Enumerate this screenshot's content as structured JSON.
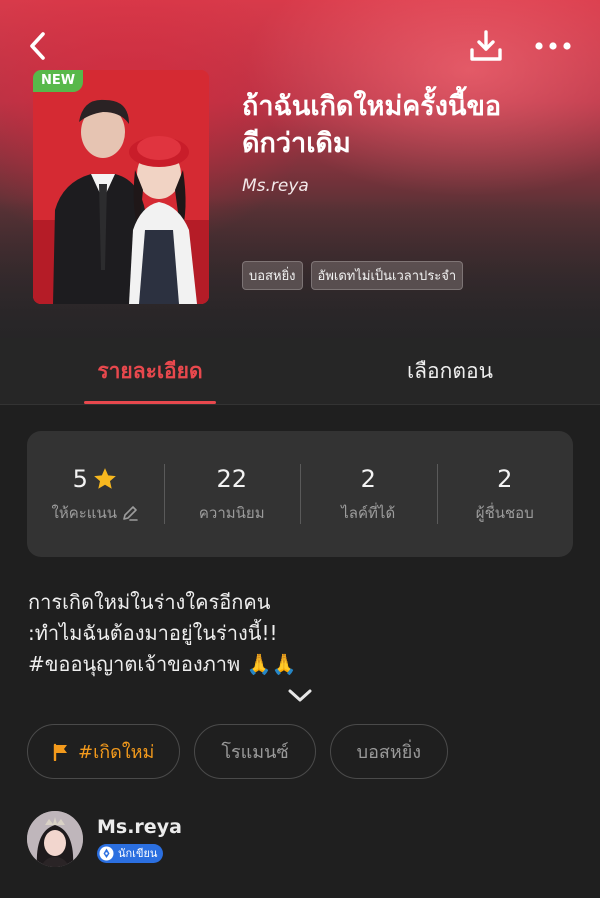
{
  "header": {
    "back_icon": "chevron-left-icon",
    "download_icon": "download-icon",
    "more_icon": "more-horizontal-icon"
  },
  "novel": {
    "badge": "NEW",
    "title_line1": "ถ้าฉันเกิดใหม่ครั้งนี้ขอ",
    "title_line2": "ดีกว่าเดิม",
    "author": "Ms.reya",
    "tags": [
      "บอสหยิ่ง",
      "อัพเดทไม่เป็นเวลาประจำ"
    ]
  },
  "tabs": {
    "details": "รายละเอียด",
    "episodes": "เลือกตอน"
  },
  "stats": [
    {
      "value": "5",
      "label": "ให้คะแนน",
      "icon": "star-icon",
      "label_icon": "pencil-icon"
    },
    {
      "value": "22",
      "label": "ความนิยม"
    },
    {
      "value": "2",
      "label": "ไลค์ที่ได้"
    },
    {
      "value": "2",
      "label": "ผู้ชื่นชอบ"
    }
  ],
  "synopsis": {
    "line1": "การเกิดใหม่ในร่างใครอีกคน",
    "line2": ":ทำไมฉันต้องมาอยู่ในร่างนี้!!",
    "line3": "#ขออนุญาตเจ้าของภาพ 🙏🙏"
  },
  "genres": [
    "#เกิดใหม่",
    "โรแมนซ์",
    "บอสหยิ่ง"
  ],
  "author_section": {
    "name": "Ms.reya",
    "badge": "นักเขียน"
  },
  "colors": {
    "accent": "#e8484d",
    "genre_highlight": "#f39a1c",
    "new_badge": "#58b84a",
    "writer_badge": "#2b6fe0",
    "background": "#1f1f1f"
  }
}
